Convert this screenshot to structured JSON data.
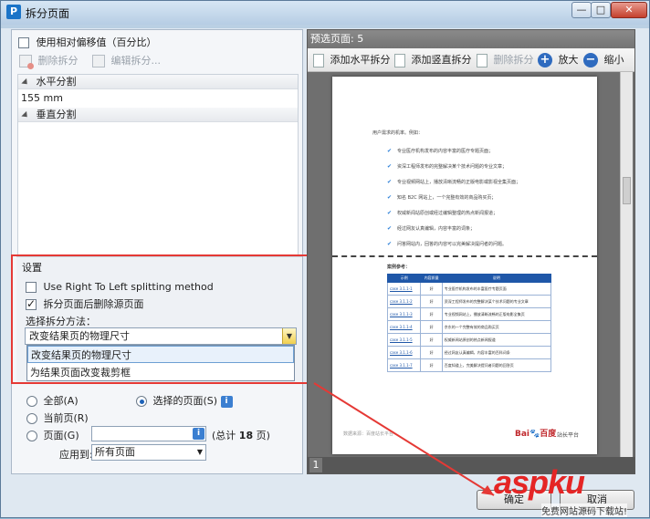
{
  "window": {
    "title": "拆分页面",
    "app_icon": "P",
    "controls": {
      "min": "—",
      "max": "□",
      "close": "✕"
    }
  },
  "left": {
    "use_relative_offset": "使用相对偏移值（百分比）",
    "toolbar": {
      "delete_split": "删除拆分",
      "edit_split": "编辑拆分..."
    },
    "horizontal_group": "水平分割",
    "horizontal_value": "155 mm",
    "vertical_group": "垂直分割",
    "settings": {
      "title": "设置",
      "rtl_label": "Use Right To Left splitting method",
      "delete_source_label": "拆分页面后删除源页面",
      "method_label": "选择拆分方法：",
      "method_selected": "改变结果页的物理尺寸",
      "method_options": [
        "改变结果页的物理尺寸",
        "为结果页面改变裁剪框"
      ]
    },
    "range": {
      "all": "全部(A)",
      "selected": "选择的页面(S)",
      "current": "当前页(R)",
      "pages": "页面(G)",
      "total_prefix": "(总计",
      "total_count": "18",
      "total_suffix": "页)",
      "apply_to_label": "应用到:",
      "apply_to_value": "所有页面",
      "info_glyph": "i"
    }
  },
  "preview": {
    "header": "预选页面: 5",
    "toolbar": {
      "add_horizontal": "添加水平拆分",
      "add_vertical": "添加竖直拆分",
      "delete_split": "删除拆分",
      "zoom_in": "放大",
      "zoom_out": "缩小"
    },
    "page": {
      "intro": "用户需求的机率。例如：",
      "bullets": [
        "专业医疗机构发布的内容丰富的医疗专题页面；",
        "资深工程师发布的完整解决某个技术问题的专业文章；",
        "专业视频网站上，播放清晰流畅的正版电影或影视全集页面；",
        "知名 B2C 网站上，一个完整有效的商品购买页；",
        "权威新闻站原创或经过编辑整理的热点新闻报道；",
        "经过网友认真编辑，内容丰富的词条；",
        "问答网站内，回答的内容可以完美解决提问者的问题。"
      ],
      "section_title": "案例参考：",
      "table_headers": [
        "示例",
        "内容质量",
        "说明"
      ],
      "table_rows": [
        [
          "case 3.1.1-1",
          "好",
          "专业医疗机构发布的丰富医疗专题页面"
        ],
        [
          "case 3.1.1-2",
          "好",
          "资深工程师发布的完整解决某个技术问题的专业文章"
        ],
        [
          "case 3.1.1-3",
          "好",
          "专业视频网站上，播放清晰流畅的正版电影全集页"
        ],
        [
          "case 3.1.1-4",
          "好",
          "京东的一个完整有效的商品购买页"
        ],
        [
          "case 3.1.1-5",
          "好",
          "权威新闻站原创的热点新闻报道"
        ],
        [
          "case 3.1.1-6",
          "好",
          "经过网友认真编辑，内容丰富的百科词条"
        ],
        [
          "case 3.1.1-7",
          "好",
          "百度知道上，完美解决提问者问题的回答页"
        ]
      ],
      "footer_left": "数据来源：百度站长平台",
      "footer_logo": "Bai🐾百度",
      "footer_right": "站长平台"
    },
    "page_number": "1"
  },
  "buttons": {
    "ok": "确定",
    "cancel": "取消"
  },
  "watermark": {
    "main": "aspku",
    "sub": "免费网站源码下载站!"
  },
  "colors": {
    "highlight": "#e53935",
    "accent": "#1f57a8"
  }
}
